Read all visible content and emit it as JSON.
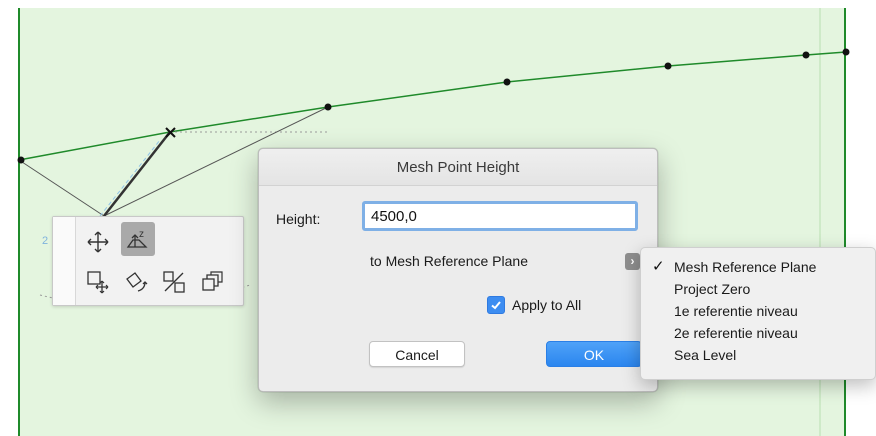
{
  "canvas": {
    "background": "#e4f5df",
    "line_color": "#1f8a2a",
    "dimension_label": "2"
  },
  "pet_palette": {
    "tools": [
      {
        "name": "move-icon",
        "selected": false
      },
      {
        "name": "elevate-z-icon",
        "selected": true
      },
      {
        "name": "drag-copy-icon",
        "selected": false
      },
      {
        "name": "rotate-icon",
        "selected": false
      },
      {
        "name": "mirror-icon",
        "selected": false
      },
      {
        "name": "multiply-icon",
        "selected": false
      }
    ]
  },
  "dialog": {
    "title": "Mesh Point Height",
    "height_label": "Height:",
    "height_value": "4500,0",
    "reference_text": "to Mesh Reference Plane",
    "reference_arrow": "›",
    "apply_label": "Apply to All",
    "apply_checked": true,
    "cancel_label": "Cancel",
    "ok_label": "OK",
    "accent": "#3d8df1"
  },
  "reference_menu": {
    "checkmark": "✓",
    "items": [
      {
        "label": "Mesh Reference Plane",
        "checked": true
      },
      {
        "label": "Project Zero",
        "checked": false
      },
      {
        "label": "1e referentie niveau",
        "checked": false
      },
      {
        "label": "2e referentie niveau",
        "checked": false
      },
      {
        "label": "Sea Level",
        "checked": false
      }
    ]
  }
}
